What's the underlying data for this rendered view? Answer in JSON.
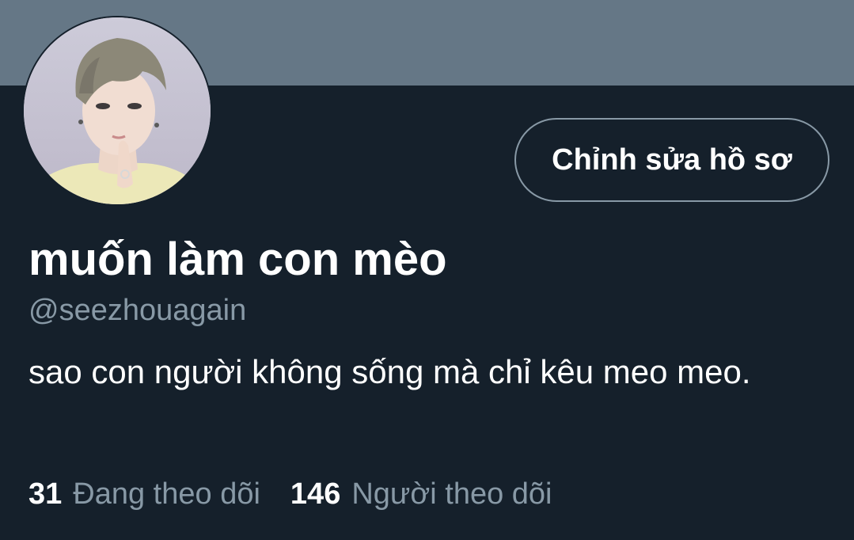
{
  "profile": {
    "display_name": "muốn làm con mèo",
    "handle": "@seezhouagain",
    "bio": "sao con người không sống mà chỉ kêu meo meo.",
    "edit_button_label": "Chỉnh sửa hồ sơ"
  },
  "stats": {
    "following_count": "31",
    "following_label": "Đang theo dõi",
    "followers_count": "146",
    "followers_label": "Người theo dõi"
  },
  "colors": {
    "background": "#15202b",
    "banner": "#657786",
    "secondary_text": "#8899a6",
    "primary_text": "#ffffff"
  }
}
